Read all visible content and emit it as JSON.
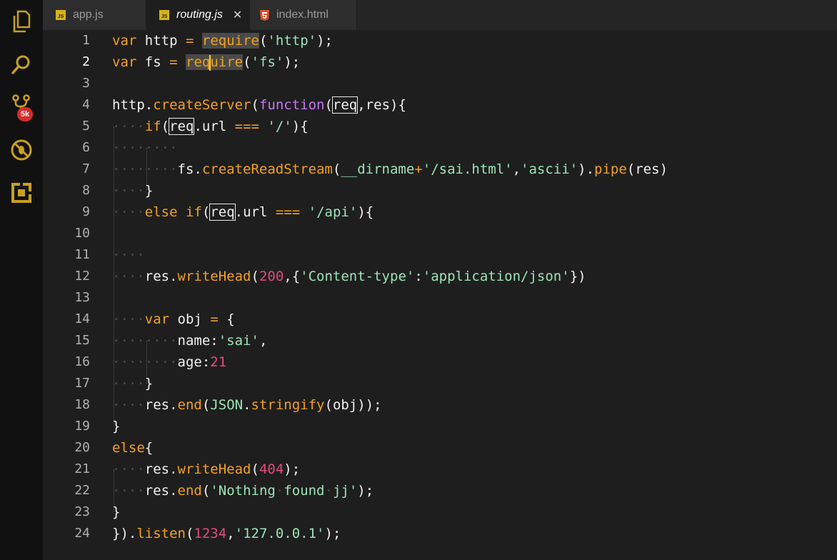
{
  "activity_bar": {
    "items": [
      {
        "name": "explorer-icon"
      },
      {
        "name": "search-icon"
      },
      {
        "name": "source-control-icon"
      },
      {
        "name": "debug-icon"
      },
      {
        "name": "extensions-icon"
      }
    ],
    "badge": "5k"
  },
  "tabs": [
    {
      "label": "app.js",
      "icon": "js-file-icon",
      "active": false
    },
    {
      "label": "routing.js",
      "icon": "js-file-icon",
      "active": true
    },
    {
      "label": "index.html",
      "icon": "html5-icon",
      "active": false
    }
  ],
  "editor": {
    "current_line": 2,
    "line_numbers": [
      "1",
      "2",
      "3",
      "4",
      "5",
      "6",
      "7",
      "8",
      "9",
      "10",
      "11",
      "12",
      "13",
      "14",
      "15",
      "16",
      "17",
      "18",
      "19",
      "20",
      "21",
      "22",
      "23",
      "24"
    ],
    "lines": [
      "var http = require('http');",
      "var fs = require('fs');",
      "",
      "http.createServer(function(req,res){",
      "    if(req.url === '/'){",
      "",
      "        fs.createReadStream(__dirname+'/sai.html','ascii').pipe(res)",
      "    }",
      "    else if(req.url === '/api'){",
      "",
      "",
      "    res.writeHead(200,{'Content-type':'application/json'})",
      "",
      "    var obj = {",
      "        name:'sai',",
      "        age:21",
      "    }",
      "    res.end(JSON.stringify(obj));",
      "}",
      "else{",
      "    res.writeHead(404);",
      "    res.end('Nothing found jj');",
      "}",
      "}).listen(1234,'127.0.0.1');"
    ]
  },
  "colors": {
    "keyword": "#f3a217",
    "string": "#9be3b7",
    "number": "#e24b7a",
    "function_keyword": "#c775f4",
    "background": "#1e1e1e"
  }
}
